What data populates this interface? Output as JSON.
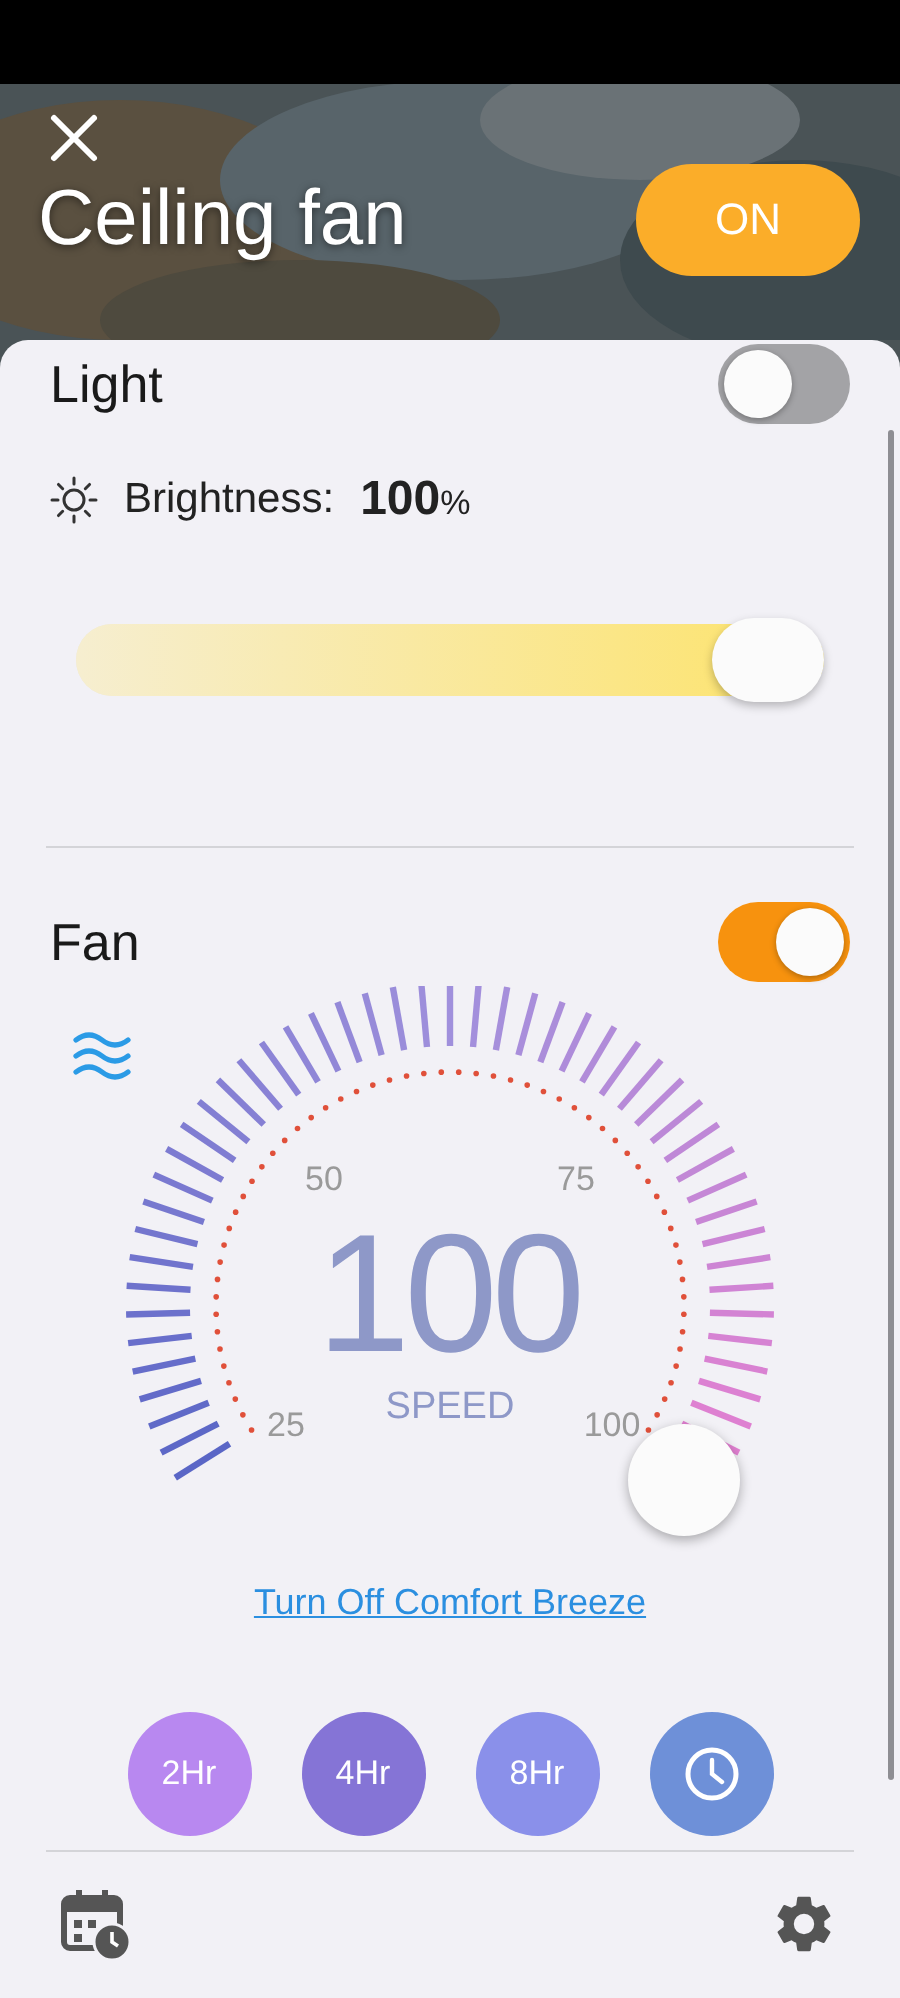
{
  "header": {
    "title": "Ceiling fan",
    "power_button": {
      "label": "ON",
      "on": true
    }
  },
  "light": {
    "title": "Light",
    "on": false,
    "brightness_label": "Brightness:",
    "brightness_value": "100",
    "brightness_unit": "%",
    "level": 1
  },
  "fan": {
    "title": "Fan",
    "on": true,
    "gauge": {
      "value": "100",
      "label": "SPEED",
      "scale": [
        "25",
        "50",
        "75",
        "100"
      ]
    },
    "link": "Turn Off Comfort Breeze",
    "timers": [
      {
        "kind": "text",
        "label": "2Hr",
        "color": "#b888f0"
      },
      {
        "kind": "text",
        "label": "4Hr",
        "color": "#8574d6"
      },
      {
        "kind": "text",
        "label": "8Hr",
        "color": "#8a90ea"
      },
      {
        "kind": "clock",
        "color": "#6e90d8"
      }
    ]
  }
}
